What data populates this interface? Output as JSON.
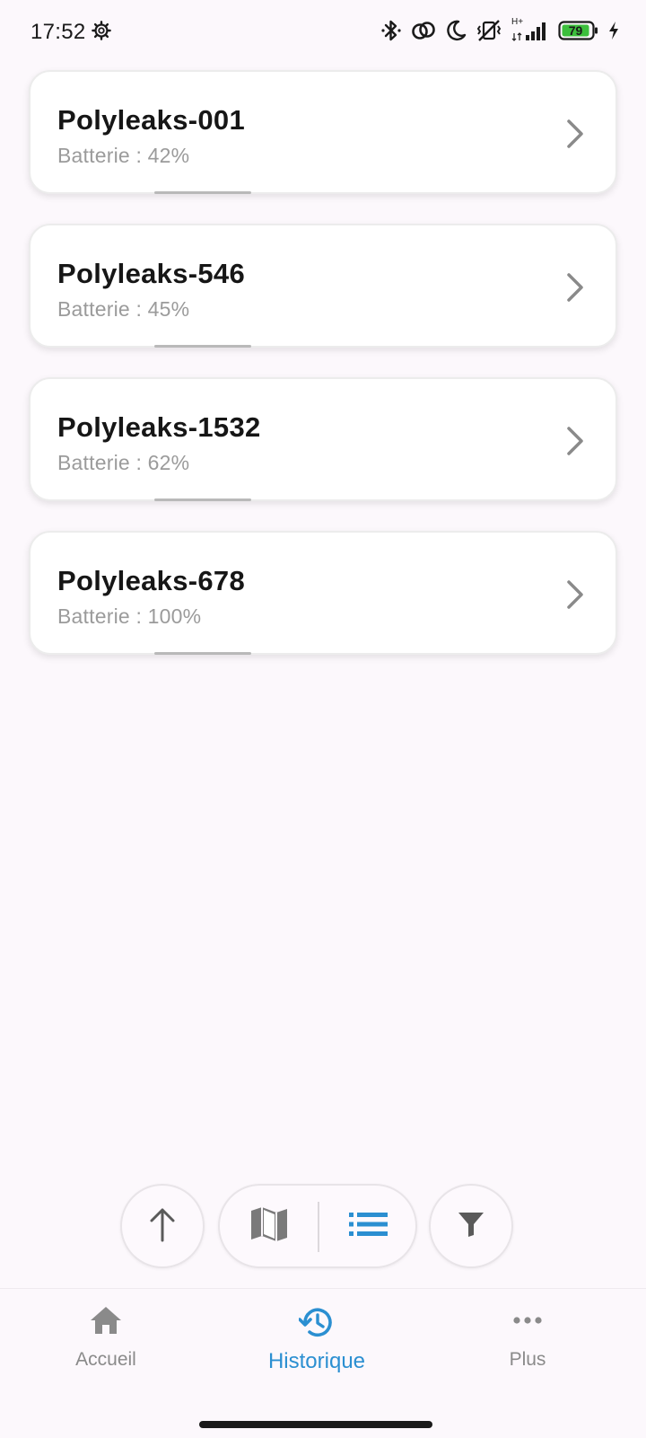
{
  "status_bar": {
    "time": "17:52",
    "network_type": "H+",
    "battery_level": "79"
  },
  "devices": [
    {
      "name": "Polyleaks-001",
      "battery": "Batterie : 42%"
    },
    {
      "name": "Polyleaks-546",
      "battery": "Batterie : 45%"
    },
    {
      "name": "Polyleaks-1532",
      "battery": "Batterie : 62%"
    },
    {
      "name": "Polyleaks-678",
      "battery": "Batterie : 100%"
    }
  ],
  "toolbar": {
    "sort_icon": "arrow-up-icon",
    "map_view_icon": "map-icon",
    "list_view_icon": "list-icon",
    "filter_icon": "filter-icon",
    "active_view": "list"
  },
  "bottom_nav": {
    "items": [
      {
        "label": "Accueil",
        "icon": "home-icon"
      },
      {
        "label": "Historique",
        "icon": "history-icon"
      },
      {
        "label": "Plus",
        "icon": "more-horizontal-icon"
      }
    ],
    "active_index": 1
  },
  "colors": {
    "accent": "#2b8fd1",
    "inactive": "#8a8a8a",
    "background": "#fcf8fc",
    "battery_fill": "#3cbf3c"
  }
}
